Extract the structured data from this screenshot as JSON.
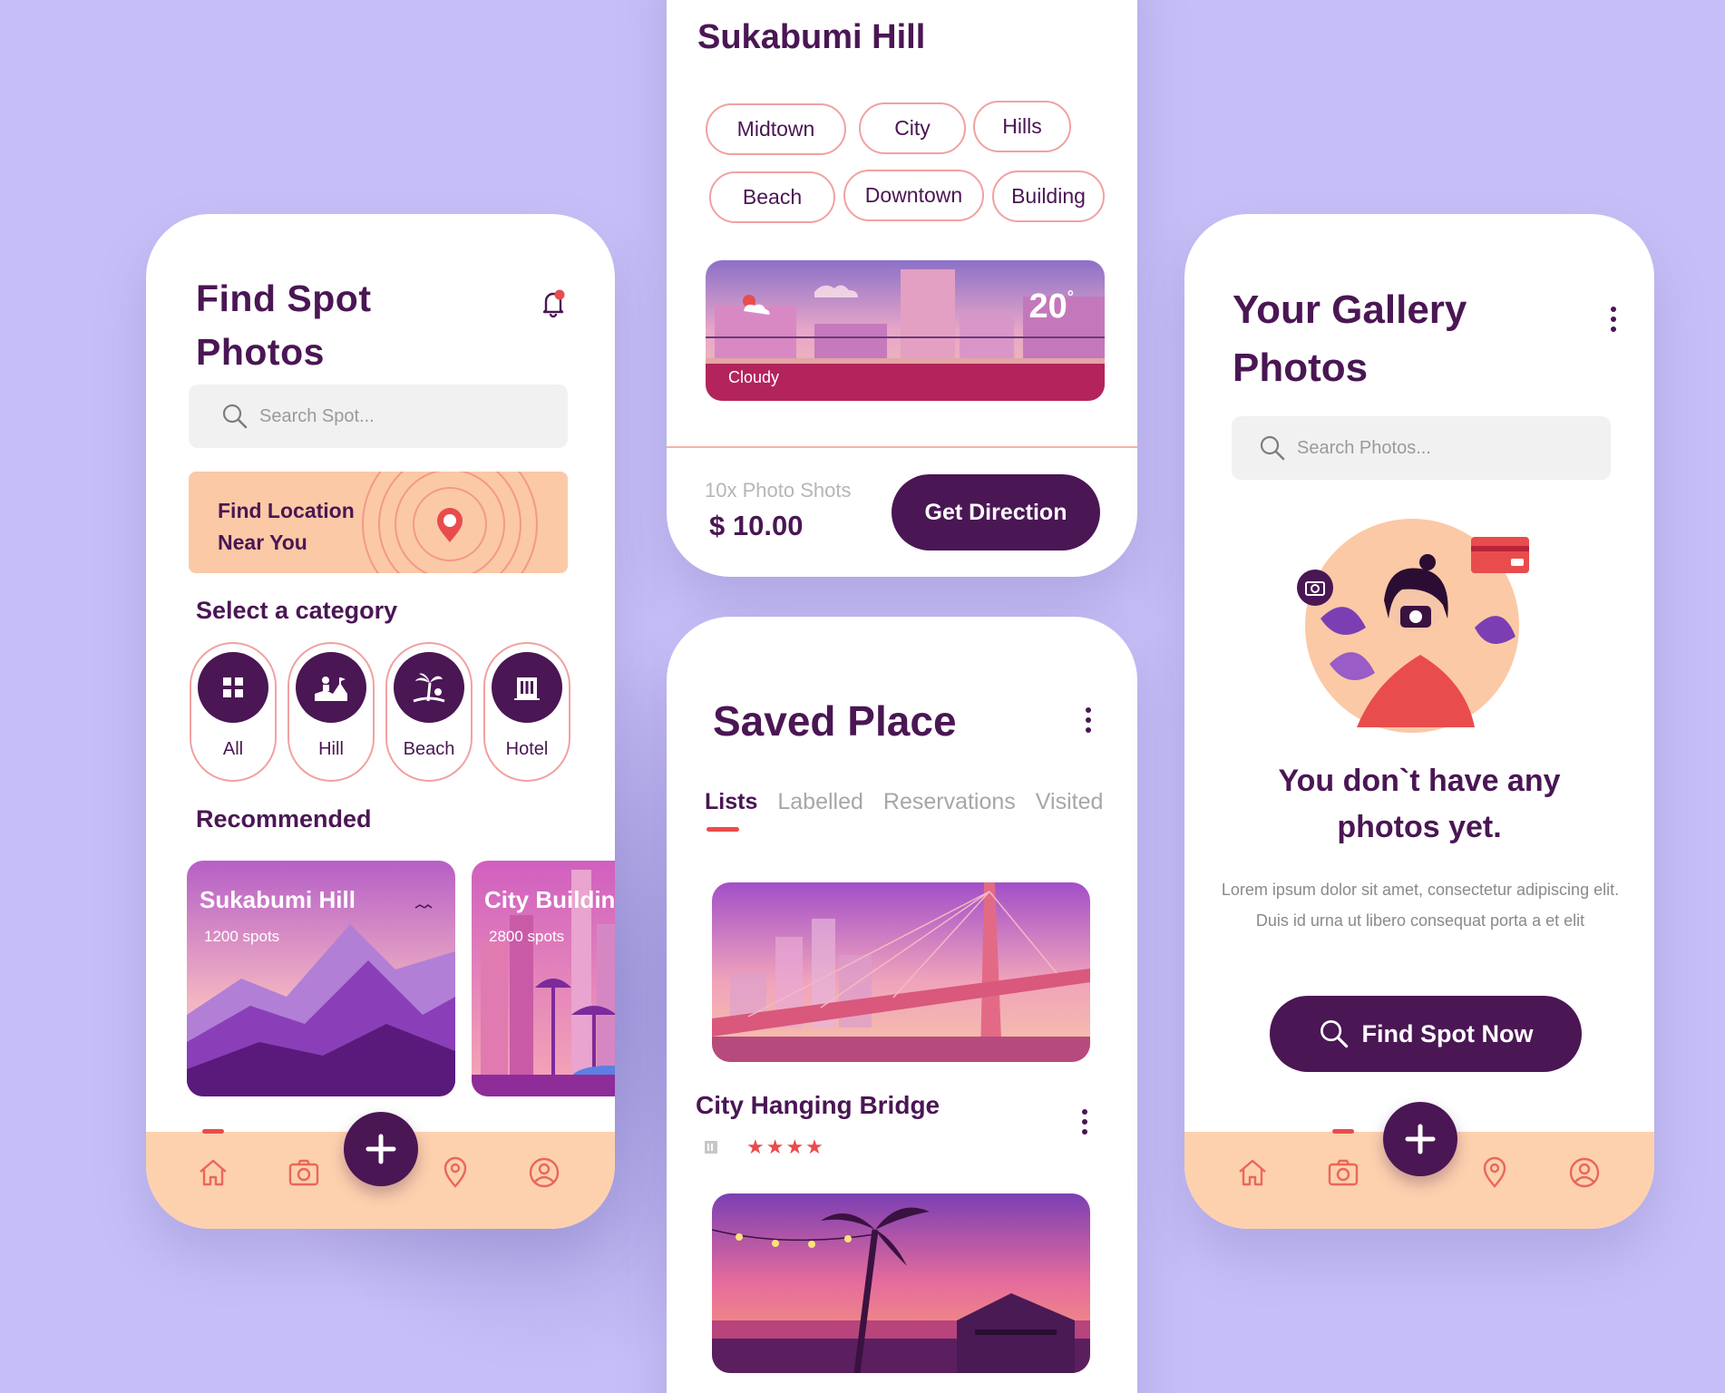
{
  "colors": {
    "background": "#c6bff7",
    "primary": "#4a1654",
    "accent": "#e94c4c",
    "peach": "#fbc9a5",
    "chip_border": "#f2a1a1"
  },
  "find_spot": {
    "title_line1": "Find Spot",
    "title_line2": "Photos",
    "bell_icon": "bell-icon",
    "search_placeholder": "Search Spot...",
    "banner_line1": "Find Location",
    "banner_line2": "Near You",
    "category_heading": "Select a category",
    "categories": [
      {
        "label": "All",
        "icon": "grid-icon"
      },
      {
        "label": "Hill",
        "icon": "hill-icon"
      },
      {
        "label": "Beach",
        "icon": "palm-icon"
      },
      {
        "label": "Hotel",
        "icon": "hotel-icon"
      }
    ],
    "recommended_heading": "Recommended",
    "recommended": [
      {
        "title": "Sukabumi Hill",
        "spots": "1200 spots"
      },
      {
        "title": "City Building",
        "spots": "2800 spots"
      }
    ]
  },
  "detail": {
    "title": "Sukabumi Hill",
    "tags_row1": [
      "Midtown",
      "City",
      "Hills"
    ],
    "tags_row2": [
      "Beach",
      "Downtown",
      "Building"
    ],
    "weather_temp": "20",
    "weather_degree": "°",
    "weather_condition": "Cloudy",
    "price_label": "10x Photo Shots",
    "price": "$ 10.00",
    "cta": "Get Direction"
  },
  "saved": {
    "title": "Saved Place",
    "tabs": [
      "Lists",
      "Labelled",
      "Reservations",
      "Visited"
    ],
    "item_title": "City Hanging Bridge",
    "rating": "★★★★"
  },
  "gallery": {
    "title_line1": "Your Gallery",
    "title_line2": "Photos",
    "search_placeholder": "Search Photos...",
    "empty_line1": "You don`t have any",
    "empty_line2": "photos yet.",
    "empty_body": "Lorem ipsum dolor sit amet, consectetur adipiscing elit. Duis id urna ut libero consequat porta a et elit",
    "cta": "Find Spot Now"
  }
}
